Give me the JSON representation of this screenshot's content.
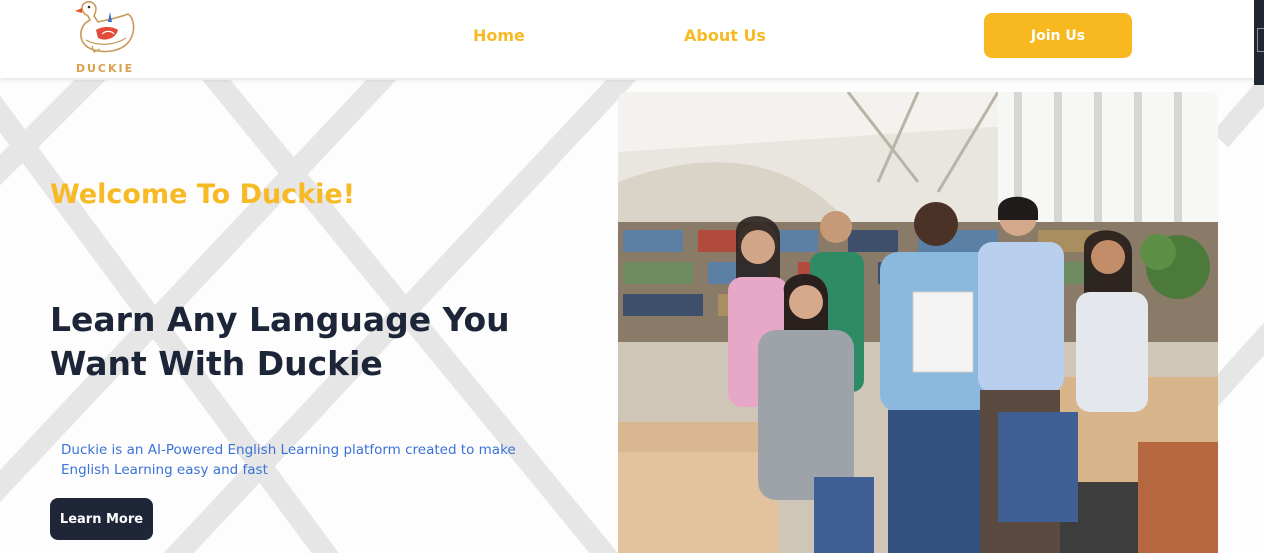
{
  "header": {
    "logo_text": "DUCKIE",
    "nav": [
      {
        "label": "Home"
      },
      {
        "label": "About Us"
      }
    ],
    "join_label": "Join Us"
  },
  "hero": {
    "welcome": "Welcome To Duckie!",
    "headline_line1": "Learn Any Language You",
    "headline_line2": "Want With Duckie",
    "description": "Duckie is an AI-Powered English Learning platform created to make English Learning easy and fast",
    "cta_label": "Learn More"
  },
  "colors": {
    "accent": "#f7b924",
    "button_yellow": "#f8b81f",
    "dark_navy": "#1e2638",
    "description_blue": "#3a72d8"
  },
  "icons": {
    "logo": "duck-logo-icon"
  },
  "image": {
    "subject": "group-of-students-in-library-photo"
  }
}
